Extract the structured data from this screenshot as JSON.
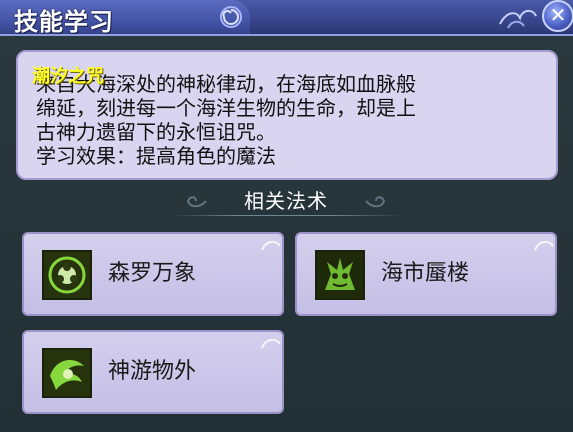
{
  "window": {
    "title": "技能学习",
    "close_icon": "close-icon"
  },
  "skill": {
    "name": "潮汐之咒",
    "description_lines": [
      "来自大海深处的神秘律动，在海底如血脉般",
      "绵延，刻进每一个海洋生物的生命，却是上",
      "古神力遗留下的永恒诅咒。",
      "学习效果：提高角色的魔法"
    ]
  },
  "related": {
    "title": "相关法术",
    "spells": [
      {
        "label": "森罗万象",
        "icon": "swirl-orb-icon"
      },
      {
        "label": "海市蜃楼",
        "icon": "mirage-creature-icon"
      },
      {
        "label": "神游物外",
        "icon": "spirit-wind-icon"
      }
    ]
  },
  "colors": {
    "title_bar": "#4555a8",
    "panel_bg": "#243237",
    "card_bg": "#d4cfed",
    "skill_name": "#ffff2a",
    "icon_green": "#7fd33a"
  }
}
